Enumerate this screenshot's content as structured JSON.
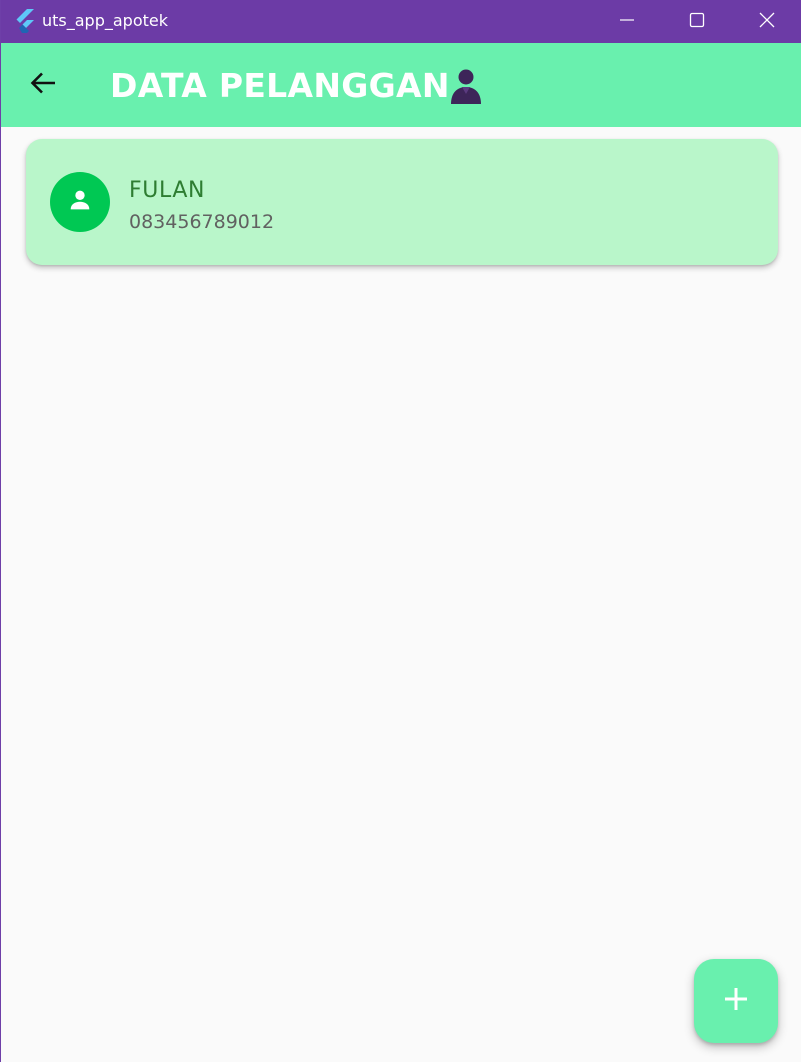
{
  "window": {
    "title": "uts_app_apotek",
    "controls": {
      "minimize_icon": "minimize-icon",
      "maximize_icon": "maximize-icon",
      "close_icon": "close-icon"
    }
  },
  "appbar": {
    "title": "DATA PELANGGAN",
    "back_icon": "arrow-back-icon",
    "title_icon": "person-emoji-icon",
    "background_color": "#69f0ae"
  },
  "customers": [
    {
      "name": "FULAN",
      "phone": "083456789012",
      "avatar_icon": "person-icon",
      "avatar_color": "#00c853",
      "card_color": "#b9f6ca"
    }
  ],
  "fab": {
    "icon": "add-icon",
    "color": "#69f0ae"
  },
  "colors": {
    "titlebar": "#6c3ba6",
    "name_text": "#2e7d32",
    "phone_text": "#616161"
  }
}
